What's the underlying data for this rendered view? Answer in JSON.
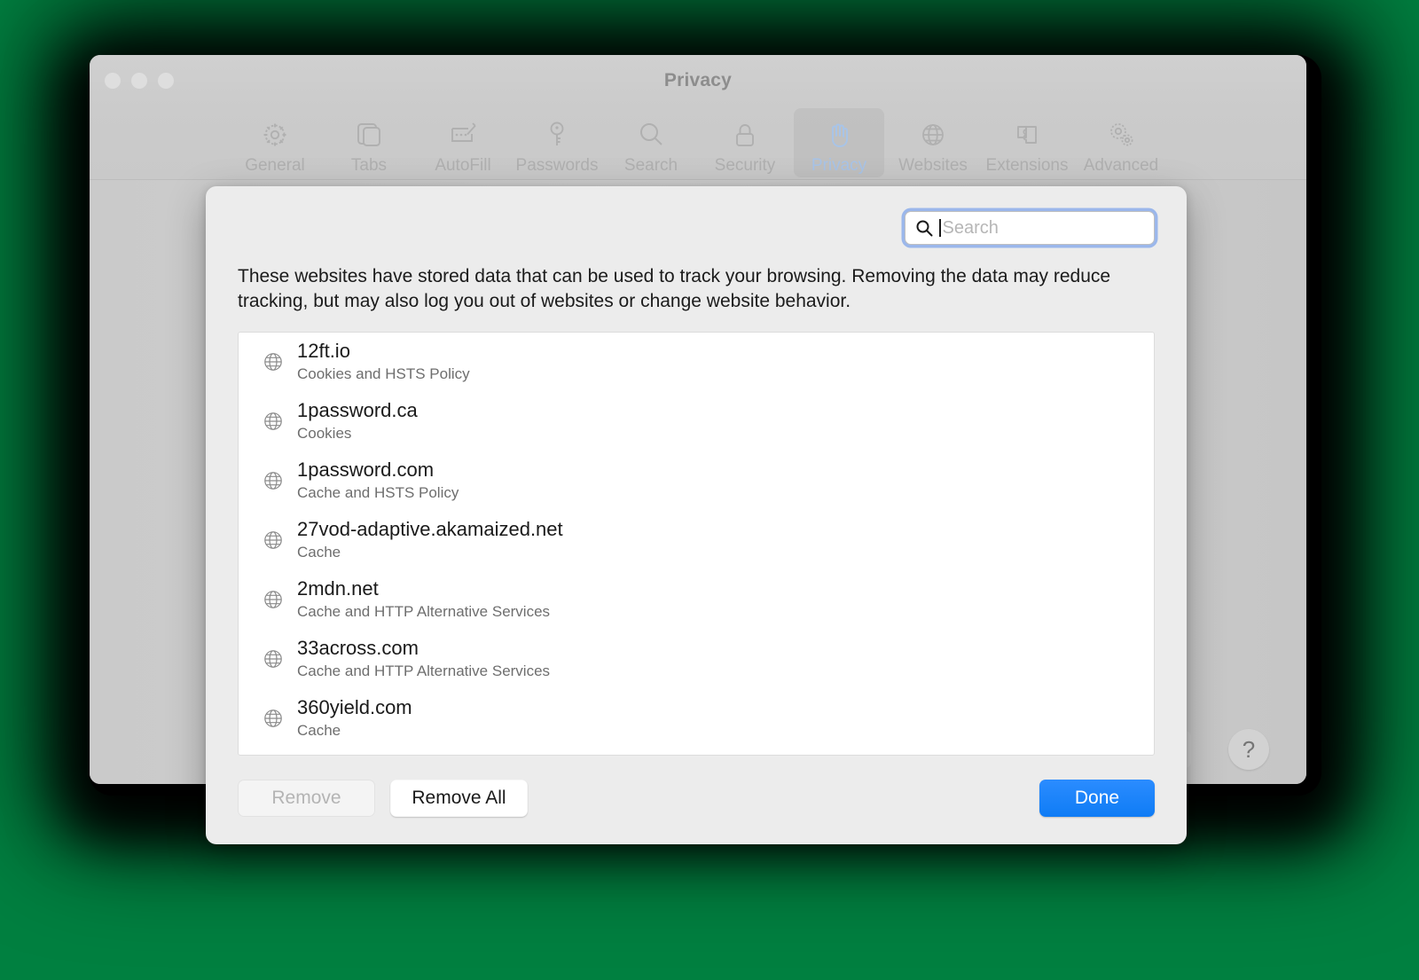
{
  "window": {
    "title": "Privacy",
    "traffic_lights": [
      "close",
      "minimize",
      "zoom"
    ]
  },
  "toolbar": {
    "items": [
      {
        "label": "General",
        "icon": "gear-icon",
        "selected": false
      },
      {
        "label": "Tabs",
        "icon": "tabs-icon",
        "selected": false
      },
      {
        "label": "AutoFill",
        "icon": "autofill-icon",
        "selected": false
      },
      {
        "label": "Passwords",
        "icon": "key-icon",
        "selected": false
      },
      {
        "label": "Search",
        "icon": "magnifier-icon",
        "selected": false
      },
      {
        "label": "Security",
        "icon": "lock-icon",
        "selected": false
      },
      {
        "label": "Privacy",
        "icon": "hand-icon",
        "selected": true
      },
      {
        "label": "Websites",
        "icon": "globe-icon",
        "selected": false
      },
      {
        "label": "Extensions",
        "icon": "puzzle-icon",
        "selected": false
      },
      {
        "label": "Advanced",
        "icon": "gears-icon",
        "selected": false
      }
    ]
  },
  "background_controls": {
    "partial_button_label": "•••",
    "help_button_label": "?"
  },
  "sheet": {
    "search": {
      "placeholder": "Search",
      "value": "",
      "icon": "search-icon"
    },
    "description": "These websites have stored data that can be used to track your browsing. Removing the data may reduce tracking, but may also log you out of websites or change website behavior.",
    "websites": [
      {
        "domain": "12ft.io",
        "data": "Cookies and HSTS Policy",
        "icon": "globe-icon"
      },
      {
        "domain": "1password.ca",
        "data": "Cookies",
        "icon": "globe-icon"
      },
      {
        "domain": "1password.com",
        "data": "Cache and HSTS Policy",
        "icon": "globe-icon"
      },
      {
        "domain": "27vod-adaptive.akamaized.net",
        "data": "Cache",
        "icon": "globe-icon"
      },
      {
        "domain": "2mdn.net",
        "data": "Cache and HTTP Alternative Services",
        "icon": "globe-icon"
      },
      {
        "domain": "33across.com",
        "data": "Cache and HTTP Alternative Services",
        "icon": "globe-icon"
      },
      {
        "domain": "360yield.com",
        "data": "Cache",
        "icon": "globe-icon"
      }
    ],
    "buttons": {
      "remove": "Remove",
      "remove_all": "Remove All",
      "done": "Done"
    }
  },
  "colors": {
    "accent_blue": "#1a84ff",
    "selected_tab_text": "#a8c4e8",
    "focus_ring": "#5a8ceb",
    "backdrop_green": "#008040"
  }
}
